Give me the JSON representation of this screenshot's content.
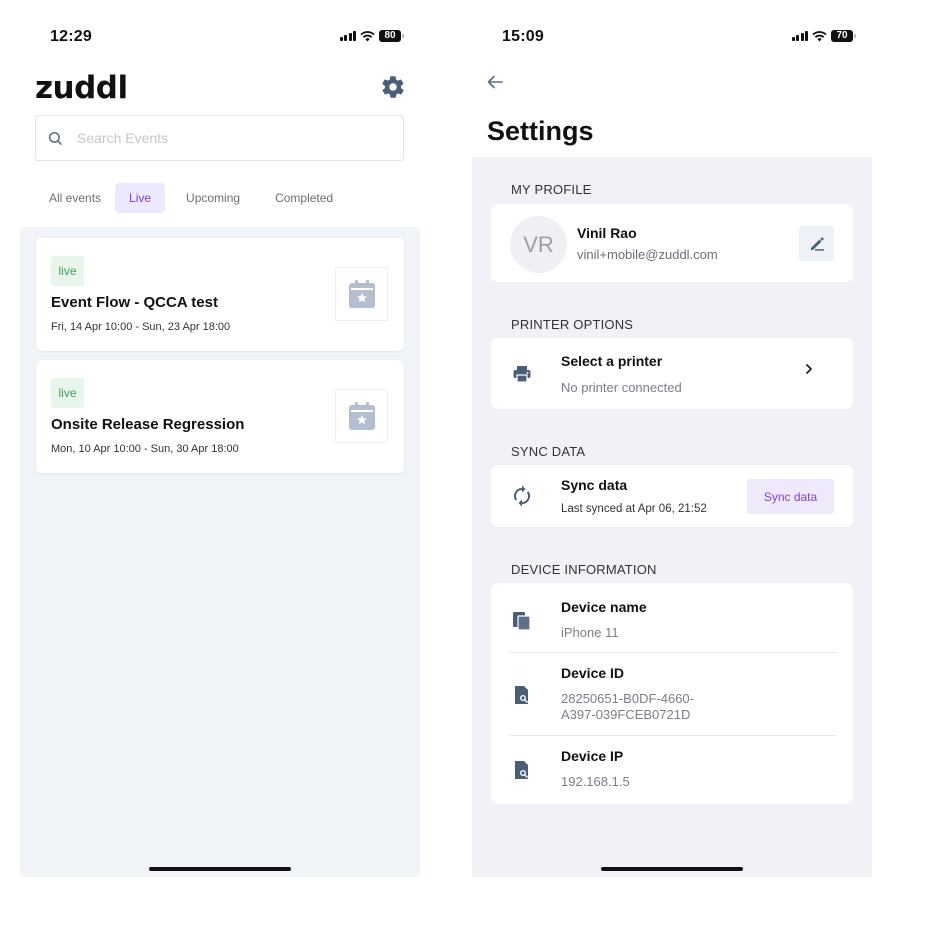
{
  "left_screen": {
    "status_bar": {
      "time": "12:29",
      "battery": "80"
    },
    "logo": "zuddl",
    "search": {
      "placeholder": "Search Events",
      "value": ""
    },
    "tabs": [
      {
        "label": "All events",
        "active": false
      },
      {
        "label": "Live",
        "active": true
      },
      {
        "label": "Upcoming",
        "active": false
      },
      {
        "label": "Completed",
        "active": false
      }
    ],
    "events": [
      {
        "badge": "live",
        "title": "Event Flow - QCCA test",
        "dates": "Fri, 14 Apr 10:00 - Sun, 23 Apr 18:00",
        "icon": "calendar-star-icon"
      },
      {
        "badge": "live",
        "title": "Onsite Release Regression",
        "dates": "Mon, 10 Apr 10:00 - Sun, 30 Apr 18:00",
        "icon": "calendar-star-icon"
      }
    ]
  },
  "right_screen": {
    "status_bar": {
      "time": "15:09",
      "battery": "70"
    },
    "title": "Settings",
    "profile": {
      "section_label": "MY PROFILE",
      "initials": "VR",
      "name": "Vinil Rao",
      "email": "vinil+mobile@zuddl.com"
    },
    "printer": {
      "section_label": "PRINTER OPTIONS",
      "title": "Select a printer",
      "subtitle": "No printer connected"
    },
    "sync": {
      "section_label": "SYNC DATA",
      "title": "Sync data",
      "subtitle": "Last synced at Apr 06, 21:52",
      "button_label": "Sync data"
    },
    "device": {
      "section_label": "DEVICE INFORMATION",
      "rows": [
        {
          "label": "Device name",
          "value": "iPhone 11"
        },
        {
          "label": "Device ID",
          "value_line1": "28250651-B0DF-4660-",
          "value_line2": "A397-039FCEB0721D"
        },
        {
          "label": "Device IP",
          "value": "192.168.1.5"
        }
      ]
    }
  },
  "colors": {
    "accent": "#7b3fe4",
    "accent_bg": "#ece8fd",
    "live_green": "#3da25a",
    "icon_slate": "#5b6b82",
    "page_bg": "#f0f3f8"
  }
}
